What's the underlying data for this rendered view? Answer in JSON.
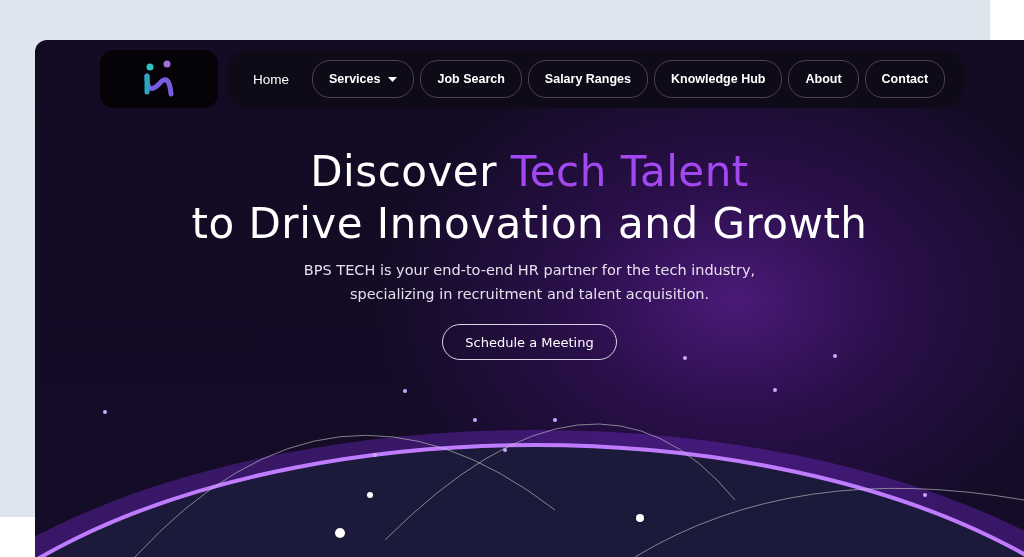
{
  "nav": {
    "items": [
      {
        "label": "Home",
        "kind": "plain",
        "has_dropdown": false
      },
      {
        "label": "Services",
        "kind": "pill",
        "has_dropdown": true
      },
      {
        "label": "Job Search",
        "kind": "pill",
        "has_dropdown": false
      },
      {
        "label": "Salary Ranges",
        "kind": "pill",
        "has_dropdown": false
      },
      {
        "label": "Knowledge Hub",
        "kind": "pill",
        "has_dropdown": false
      },
      {
        "label": "About",
        "kind": "pill",
        "has_dropdown": false
      },
      {
        "label": "Contact",
        "kind": "pill",
        "has_dropdown": false
      }
    ]
  },
  "hero": {
    "title_lead": "Discover",
    "title_highlight": "Tech Talent",
    "title_line_2": "to Drive Innovation and Growth",
    "subtitle": "BPS TECH is your end-to-end HR partner for the tech industry, specializing in recruitment and talent acquisition.",
    "cta": "Schedule a Meeting"
  }
}
